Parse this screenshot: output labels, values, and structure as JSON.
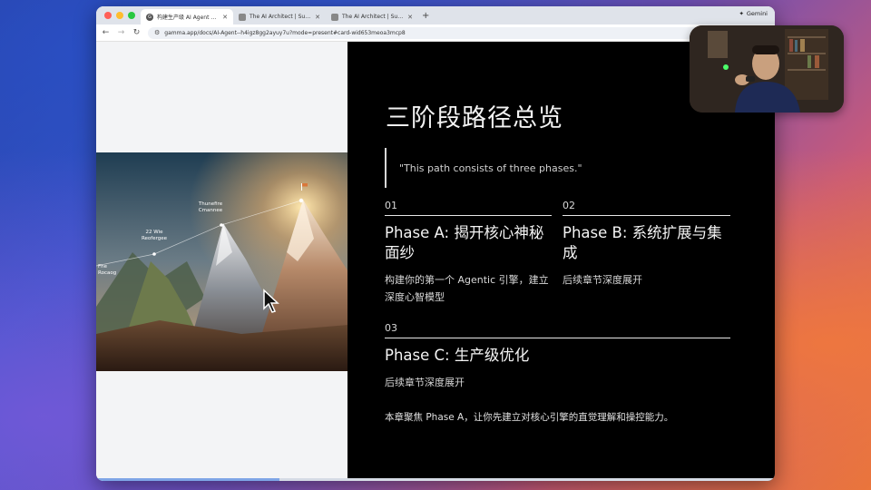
{
  "browser": {
    "tabs": [
      {
        "title": "构建生产级 AI Agent 系统的认",
        "icon": "gamma-icon",
        "active": true
      },
      {
        "title": "The AI Architect | Superlinea",
        "icon": "doc-icon",
        "active": false
      },
      {
        "title": "The AI Architect | Superlinea",
        "icon": "doc-icon",
        "active": false
      }
    ],
    "new_tab": "+",
    "gemini_label": "Gemini",
    "url": "gamma.app/docs/AI-Agent--h4igz8gg2ayuy7u?mode=present#card-wid653meoa3mcp8"
  },
  "slide": {
    "title": "三阶段路径总览",
    "quote": "\"This path consists of three phases.\"",
    "image_labels": {
      "peak1": "Thunefire\nCmannee",
      "peak2": "22 Wie\nReofergee",
      "peak3": "Fhe\nRocaog"
    },
    "phases": [
      {
        "num": "01",
        "title": "Phase A: 揭开核心神秘面纱",
        "desc": "构建你的第一个 Agentic 引擎，建立深度心智模型"
      },
      {
        "num": "02",
        "title": "Phase B: 系统扩展与集成",
        "desc": "后续章节深度展开"
      },
      {
        "num": "03",
        "title": "Phase C: 生产级优化",
        "desc": "后续章节深度展开"
      }
    ],
    "footnote": "本章聚焦 Phase A，让你先建立对核心引擎的直觉理解和操控能力。"
  },
  "colors": {
    "slide_bg": "#000000",
    "text": "#f2f2f2",
    "progress": "#7ea5e6"
  }
}
